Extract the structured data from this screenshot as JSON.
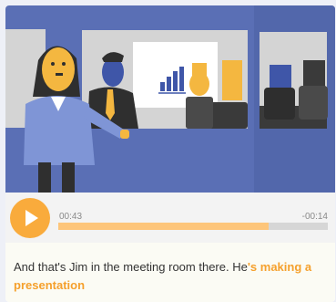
{
  "player": {
    "elapsed": "00:43",
    "remaining": "-00:14",
    "progress": 0.78
  },
  "subtitle": {
    "plain": "And that's Jim in the meeting room there. He",
    "highlight": "'s making a presentation"
  },
  "colors": {
    "accent": "#f9ab3c",
    "highlight_text": "#f5a02c",
    "scene_background": "#5a6fb5"
  },
  "icons": {
    "play": "play-icon"
  }
}
